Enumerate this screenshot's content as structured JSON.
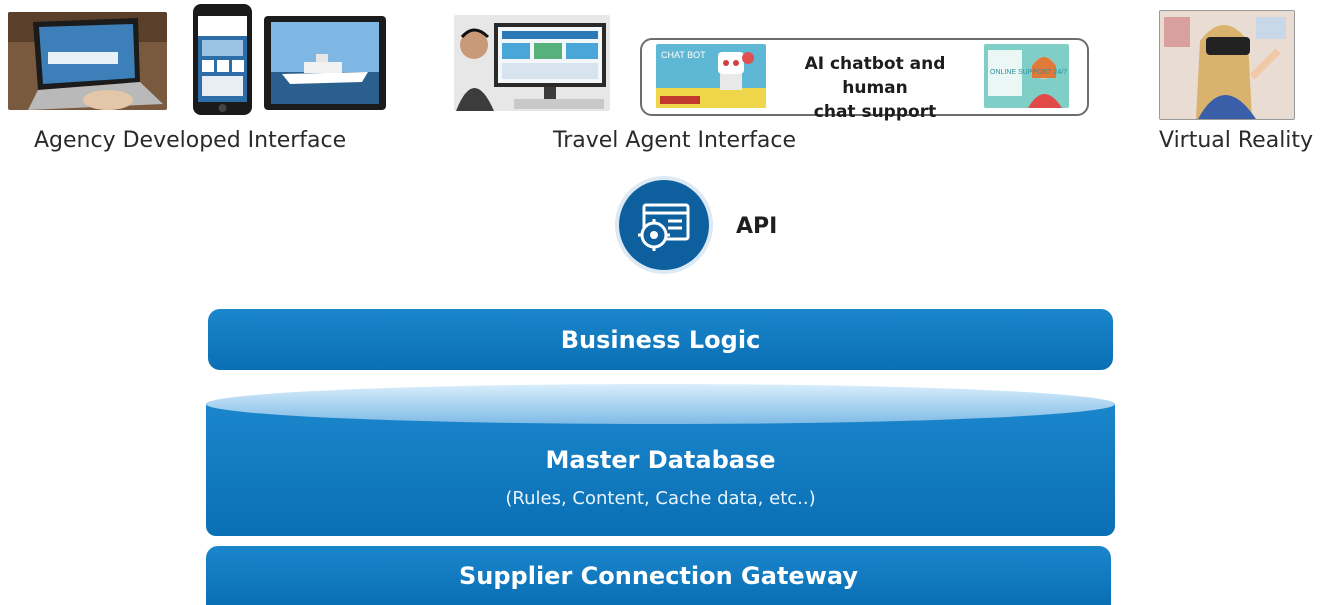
{
  "clients": {
    "agency_label": "Agency Developed Interface",
    "travel_agent_label": "Travel Agent Interface",
    "vr_label": "Virtual Reality",
    "chatbot": {
      "line1": "AI chatbot and human",
      "line2": "chat support",
      "left_image_text": "CHAT BOT",
      "right_image_text": "ONLINE SUPPORT 24/7"
    }
  },
  "api": {
    "label": "API",
    "icon": "gear-window-icon"
  },
  "layers": {
    "business_logic": "Business Logic",
    "master_database": "Master Database",
    "master_database_sub": "(Rules, Content, Cache data, etc..)",
    "gateway": "Supplier Connection Gateway"
  },
  "colors": {
    "band_blue": "#0a6fb4",
    "band_light": "#b9dcf5",
    "api_circle": "#0d5f9e"
  }
}
